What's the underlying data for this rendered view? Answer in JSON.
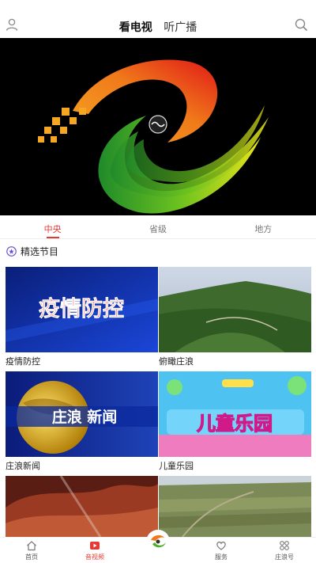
{
  "header": {
    "tabs": [
      {
        "label": "看电视",
        "active": true
      },
      {
        "label": "听广播",
        "active": false
      }
    ],
    "icons": {
      "user": "user-icon",
      "search": "search-icon"
    }
  },
  "player": {
    "logo": "station-logo",
    "control": "play-indicator-icon"
  },
  "category_tabs": [
    {
      "label": "中央",
      "active": true
    },
    {
      "label": "省级",
      "active": false
    },
    {
      "label": "地方",
      "active": false
    }
  ],
  "section": {
    "title": "精选节目",
    "icon": "star-badge-icon"
  },
  "programs": [
    {
      "title": "疫情防控",
      "thumb_text": "疫情防控"
    },
    {
      "title": "俯瞰庄浪",
      "thumb_text": ""
    },
    {
      "title": "庄浪新闻",
      "thumb_text": "庄浪 新闻"
    },
    {
      "title": "儿童乐园",
      "thumb_text": "儿童乐园"
    },
    {
      "title": "",
      "thumb_text": ""
    },
    {
      "title": "",
      "thumb_text": ""
    }
  ],
  "bottom_nav": [
    {
      "label": "首页",
      "icon": "home-icon",
      "active": false
    },
    {
      "label": "音视频",
      "icon": "play-icon",
      "active": true
    },
    {
      "label": "",
      "icon": "center-logo-icon",
      "active": false
    },
    {
      "label": "服务",
      "icon": "heart-icon",
      "active": false
    },
    {
      "label": "庄浪号",
      "icon": "grid-icon",
      "active": false
    }
  ],
  "colors": {
    "accent": "#e53935",
    "text": "#222222"
  }
}
